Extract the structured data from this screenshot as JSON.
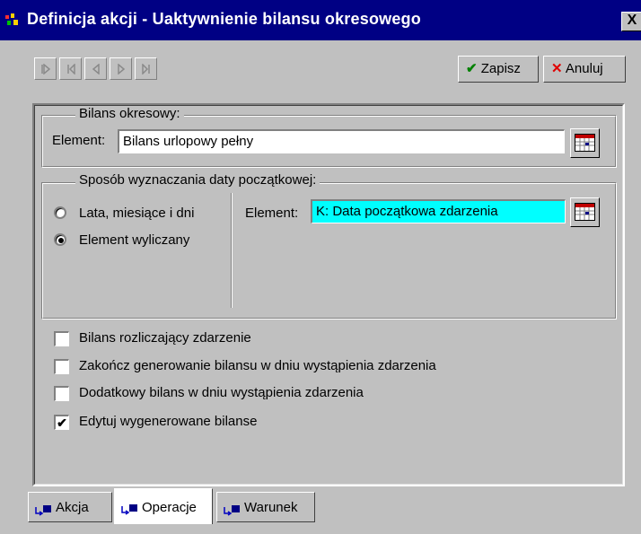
{
  "window": {
    "title": "Definicja akcji - Uaktywnienie bilansu okresowego",
    "close": "X"
  },
  "toolbar": {
    "nav": [
      "first-icon",
      "prev-group-icon",
      "prev-icon",
      "next-icon",
      "last-icon"
    ],
    "save_label": "Zapisz",
    "cancel_label": "Anuluj"
  },
  "bilans": {
    "legend": "Bilans okresowy:",
    "element_label": "Element:",
    "element_value": "Bilans urlopowy pełny"
  },
  "date": {
    "legend": "Sposób wyznaczania daty początkowej:",
    "options": [
      "Lata, miesiące i dni",
      "Element wyliczany"
    ],
    "selected_index": 1,
    "element_label": "Element:",
    "element_value": "K: Data początkowa zdarzenia"
  },
  "checks": [
    {
      "label": "Bilans rozliczający zdarzenie",
      "checked": false,
      "mark": ""
    },
    {
      "label": "Zakończ generowanie bilansu w dniu wystąpienia zdarzenia",
      "checked": false,
      "mark": ""
    },
    {
      "label": "Dodatkowy bilans w dniu wystąpienia zdarzenia",
      "checked": false,
      "mark": ""
    },
    {
      "label": "Edytuj wygenerowane bilanse",
      "checked": true,
      "mark": "✔"
    }
  ],
  "tabs": [
    {
      "label": "Akcja",
      "active": false
    },
    {
      "label": "Operacje",
      "active": true
    },
    {
      "label": "Warunek",
      "active": false
    }
  ],
  "colors": {
    "titlebar": "#000084",
    "face": "#c0c0c0",
    "highlight_field": "#00ffff",
    "save_check": "#008000",
    "cancel_x": "#e00000"
  }
}
